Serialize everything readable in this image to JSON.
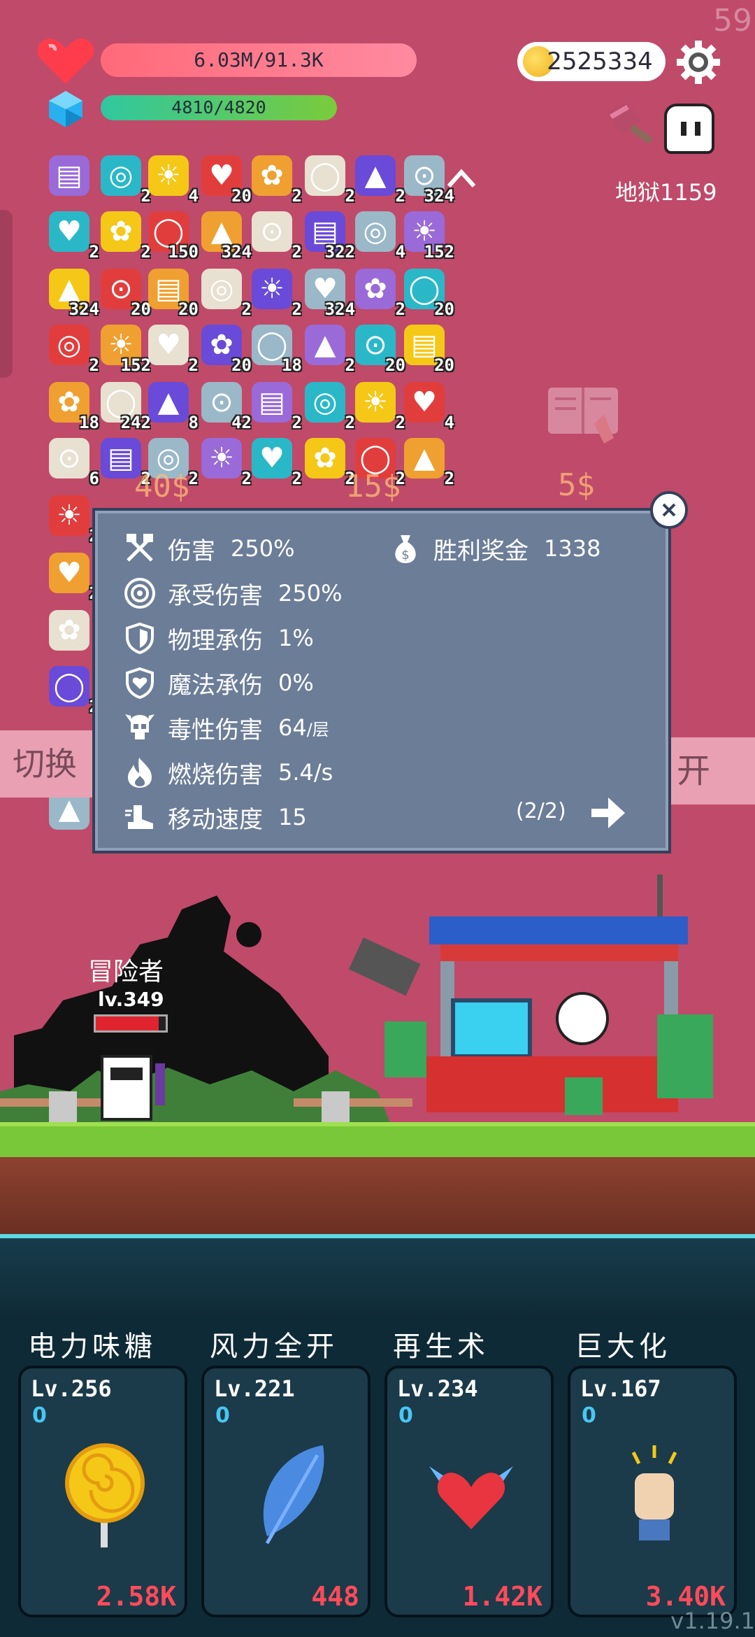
{
  "fps": "59",
  "hp_text": "6.03M/91.3K",
  "mp_text": "4810/4820",
  "coins": "2525334",
  "level_label": "地狱1159",
  "items_row1": [
    "",
    "2",
    "4",
    "20",
    "2",
    "2",
    "2",
    "324"
  ],
  "items_row2": [
    "2",
    "2",
    "150",
    "324",
    "2",
    "322",
    "4",
    "152"
  ],
  "items_row3": [
    "324",
    "20",
    "20",
    "2",
    "2",
    "324",
    "2",
    "20"
  ],
  "items_row4": [
    "2",
    "152",
    "2",
    "20",
    "18",
    "2",
    "20",
    "20"
  ],
  "items_row5": [
    "18",
    "242",
    "8",
    "42",
    "2",
    "2",
    "2",
    "4"
  ],
  "items_row6": [
    "6",
    "2",
    "2",
    "2",
    "2",
    "2",
    "2",
    "2"
  ],
  "items_left": [
    "2",
    "2",
    "",
    "2",
    ""
  ],
  "shop_prices": [
    "40$",
    "15$",
    "5$"
  ],
  "switch_label": "切换",
  "open_label": "开",
  "stats": {
    "damage_label": "伤害",
    "damage_value": "250%",
    "bonus_label": "胜利奖金",
    "bonus_value": "1338",
    "taken_label": "承受伤害",
    "taken_value": "250%",
    "phys_label": "物理承伤",
    "phys_value": "1%",
    "magic_label": "魔法承伤",
    "magic_value": "0%",
    "poison_label": "毒性伤害",
    "poison_value": "64",
    "poison_unit": "/层",
    "burn_label": "燃烧伤害",
    "burn_value": "5.4/s",
    "speed_label": "移动速度",
    "speed_value": "15",
    "page": "(2/2)"
  },
  "hero": {
    "name": "冒险者",
    "level": "lv.349",
    "hp_fraction": 0.9
  },
  "skills": [
    {
      "title": "电力味糖",
      "level": "Lv.256",
      "points": "0",
      "cost": "2.58K"
    },
    {
      "title": "风力全开",
      "level": "Lv.221",
      "points": "0",
      "cost": "448"
    },
    {
      "title": "再生术",
      "level": "Lv.234",
      "points": "0",
      "cost": "1.42K"
    },
    {
      "title": "巨大化",
      "level": "Lv.167",
      "points": "0",
      "cost": "3.40K"
    }
  ],
  "version": "v1.19.1",
  "colors": {
    "background": "#c04a6a",
    "popup": "#6c7d98",
    "panel": "#0e2a36",
    "cost": "#ff4a5a"
  }
}
